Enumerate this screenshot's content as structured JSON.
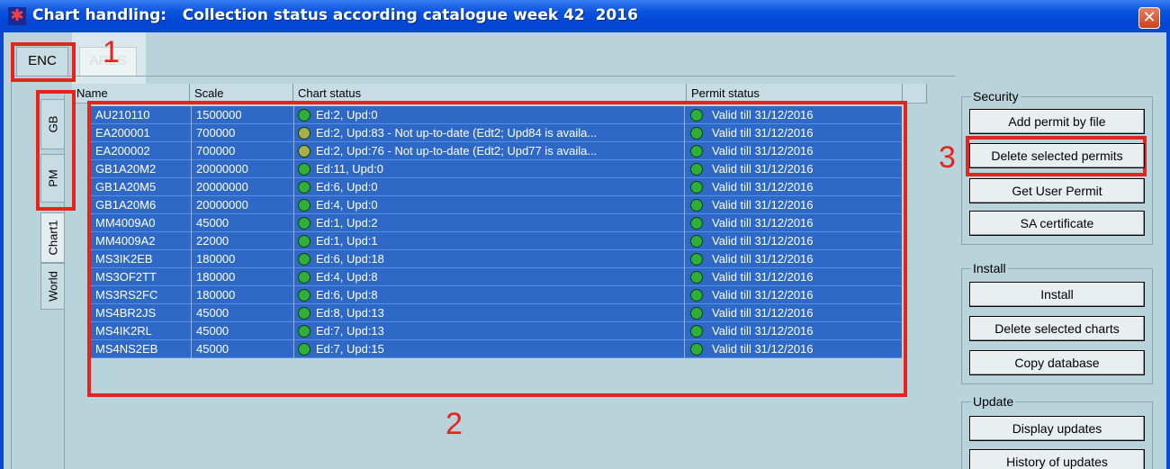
{
  "title": "Chart handling:   Collection status according catalogue week 42  2016",
  "top_tabs": [
    "ENC",
    "ARES"
  ],
  "side_tabs": [
    "GB",
    "PM",
    "Chart1",
    "World"
  ],
  "columns": [
    "Name",
    "Scale",
    "Chart status",
    "Permit status"
  ],
  "rows": [
    {
      "name": "AU210110",
      "scale": "1500000",
      "chart_status": "Ed:2, Upd:0",
      "chart_status_color": "#2fae3a",
      "permit_status": "Valid till 31/12/2016"
    },
    {
      "name": "EA200001",
      "scale": "700000",
      "chart_status": "Ed:2, Upd:83 - Not up-to-date (Edt2; Upd84 is availa...",
      "chart_status_color": "#a8b04a",
      "permit_status": "Valid till 31/12/2016"
    },
    {
      "name": "EA200002",
      "scale": "700000",
      "chart_status": "Ed:2, Upd:76 - Not up-to-date (Edt2; Upd77 is availa...",
      "chart_status_color": "#a8b04a",
      "permit_status": "Valid till 31/12/2016"
    },
    {
      "name": "GB1A20M2",
      "scale": "20000000",
      "chart_status": "Ed:11, Upd:0",
      "chart_status_color": "#2fae3a",
      "permit_status": "Valid till 31/12/2016"
    },
    {
      "name": "GB1A20M5",
      "scale": "20000000",
      "chart_status": "Ed:6, Upd:0",
      "chart_status_color": "#2fae3a",
      "permit_status": "Valid till 31/12/2016"
    },
    {
      "name": "GB1A20M6",
      "scale": "20000000",
      "chart_status": "Ed:4, Upd:0",
      "chart_status_color": "#2fae3a",
      "permit_status": "Valid till 31/12/2016"
    },
    {
      "name": "MM4009A0",
      "scale": "45000",
      "chart_status": "Ed:1, Upd:2",
      "chart_status_color": "#2fae3a",
      "permit_status": "Valid till 31/12/2016"
    },
    {
      "name": "MM4009A2",
      "scale": "22000",
      "chart_status": "Ed:1, Upd:1",
      "chart_status_color": "#2fae3a",
      "permit_status": "Valid till 31/12/2016"
    },
    {
      "name": "MS3IK2EB",
      "scale": "180000",
      "chart_status": "Ed:6, Upd:18",
      "chart_status_color": "#2fae3a",
      "permit_status": "Valid till 31/12/2016"
    },
    {
      "name": "MS3OF2TT",
      "scale": "180000",
      "chart_status": "Ed:4, Upd:8",
      "chart_status_color": "#2fae3a",
      "permit_status": "Valid till 31/12/2016"
    },
    {
      "name": "MS3RS2FC",
      "scale": "180000",
      "chart_status": "Ed:6, Upd:8",
      "chart_status_color": "#2fae3a",
      "permit_status": "Valid till 31/12/2016"
    },
    {
      "name": "MS4BR2JS",
      "scale": "45000",
      "chart_status": "Ed:8, Upd:13",
      "chart_status_color": "#2fae3a",
      "permit_status": "Valid till 31/12/2016"
    },
    {
      "name": "MS4IK2RL",
      "scale": "45000",
      "chart_status": "Ed:7, Upd:13",
      "chart_status_color": "#2fae3a",
      "permit_status": "Valid till 31/12/2016"
    },
    {
      "name": "MS4NS2EB",
      "scale": "45000",
      "chart_status": "Ed:7, Upd:15",
      "chart_status_color": "#2fae3a",
      "permit_status": "Valid till 31/12/2016"
    }
  ],
  "permit_status_color": "#2fae3a",
  "security": {
    "legend": "Security",
    "buttons": [
      "Add permit by file",
      "Delete selected permits",
      "Get User Permit",
      "SA certificate"
    ]
  },
  "install": {
    "legend": "Install",
    "buttons": [
      "Install",
      "Delete selected charts",
      "Copy database"
    ]
  },
  "update": {
    "legend": "Update",
    "buttons": [
      "Display updates",
      "History of updates"
    ]
  },
  "annotations": [
    "1",
    "2",
    "3"
  ],
  "colors": {
    "annotation_red": "#e8231b",
    "selection_blue": "#2f69c8",
    "window_bg": "#b9d3db",
    "titlebar_blue": "#0046d5"
  }
}
